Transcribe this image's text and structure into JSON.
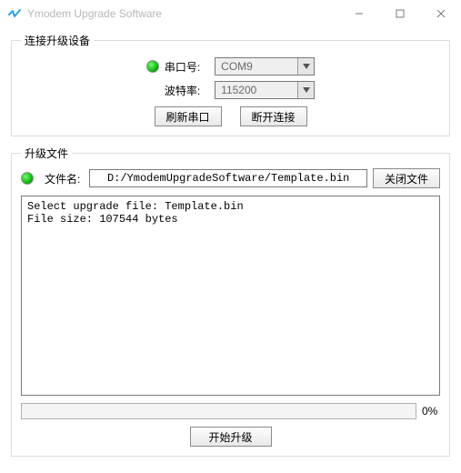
{
  "window": {
    "title": "Ymodem Upgrade Software"
  },
  "device": {
    "legend": "连接升级设备",
    "port_label": "串口号:",
    "port_value": "COM9",
    "baud_label": "波特率:",
    "baud_value": "115200",
    "refresh_label": "刷新串口",
    "disconnect_label": "断开连接"
  },
  "file": {
    "legend": "升级文件",
    "name_label": "文件名:",
    "path": "D:/YmodemUpgradeSoftware/Template.bin",
    "close_label": "关闭文件",
    "log": "Select upgrade file: Template.bin\nFile size: 107544 bytes",
    "progress_pct": "0%",
    "start_label": "开始升级"
  },
  "colors": {
    "led_on": "#0eb80e"
  }
}
